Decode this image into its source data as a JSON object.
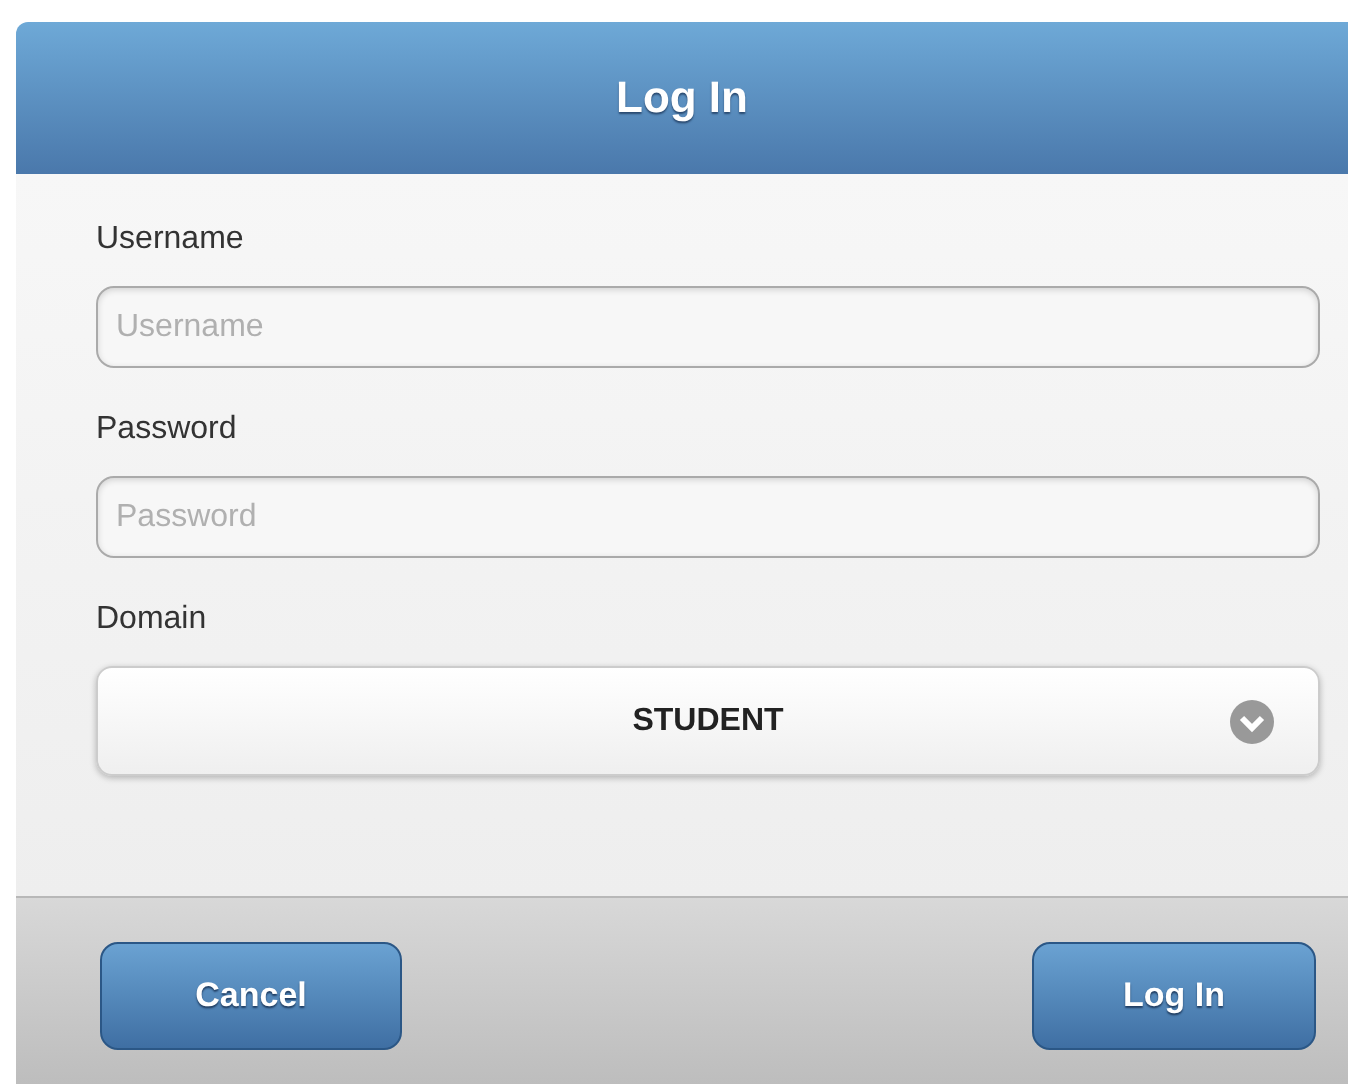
{
  "header": {
    "title": "Log In"
  },
  "fields": [
    {
      "kind": "text",
      "label": "Username",
      "placeholder": "Username"
    },
    {
      "kind": "text",
      "label": "Password",
      "placeholder": "Password"
    },
    {
      "kind": "select",
      "label": "Domain",
      "value": "STUDENT"
    }
  ],
  "buttons": [
    "Cancel",
    "Log In"
  ]
}
